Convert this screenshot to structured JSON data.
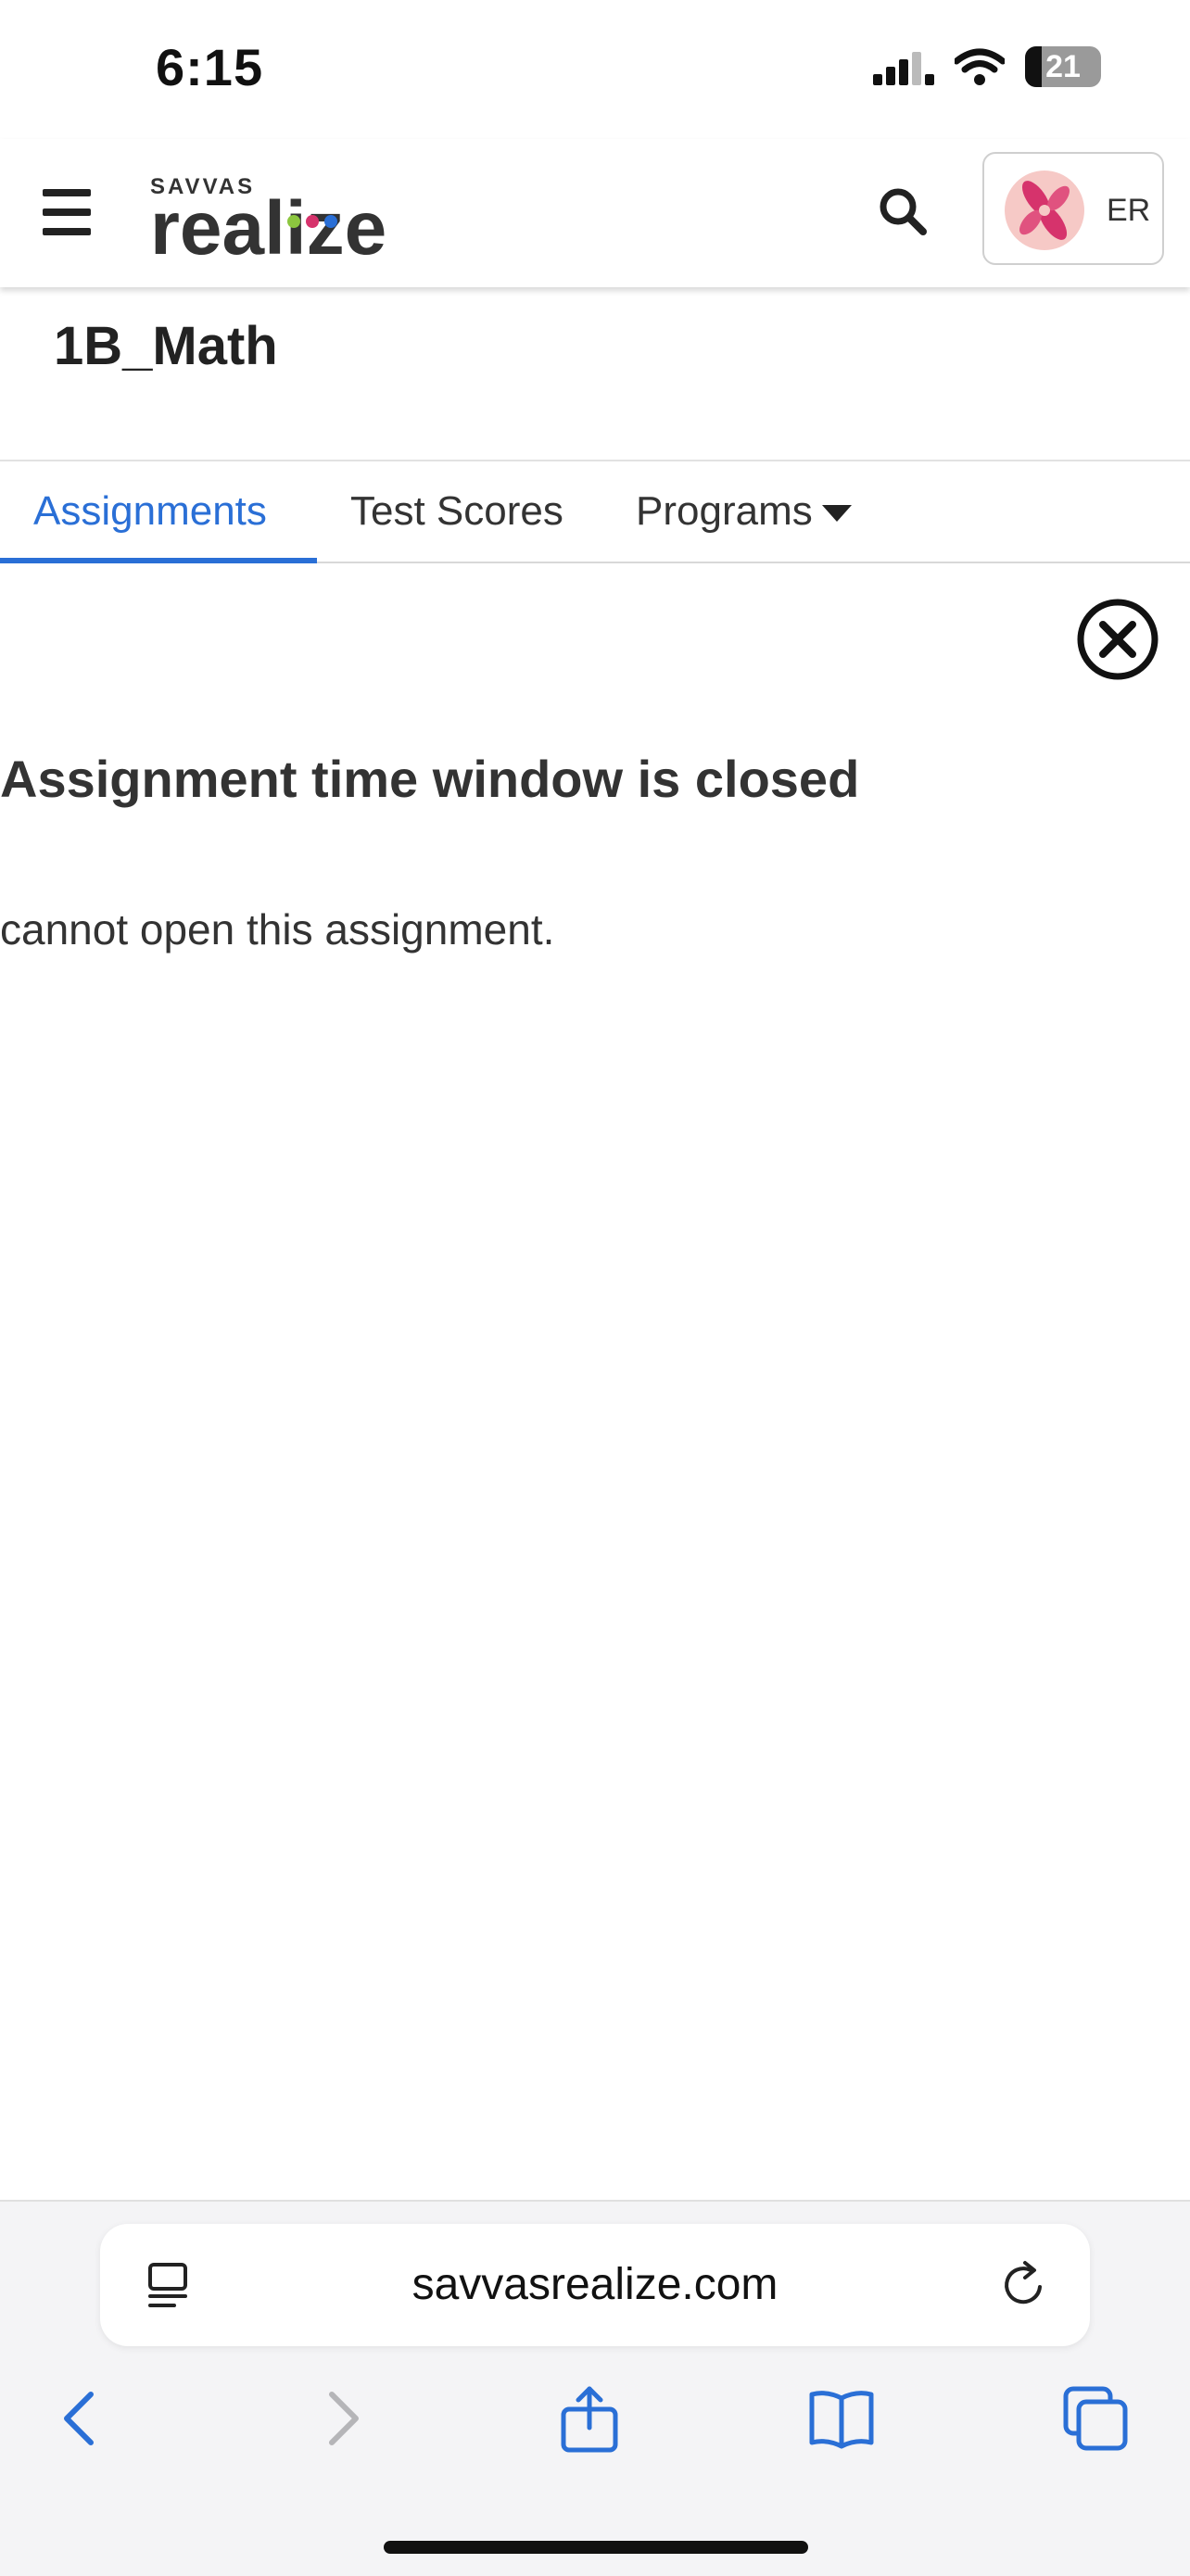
{
  "status_bar": {
    "time": "6:15",
    "battery": "21"
  },
  "header": {
    "logo_top": "SAVVAS",
    "logo_main": "realize",
    "profile_initials": "ER"
  },
  "class_title": "1B_Math",
  "tabs": [
    {
      "label": "Assignments",
      "active": true
    },
    {
      "label": "Test Scores",
      "active": false
    },
    {
      "label": "Programs",
      "active": false
    }
  ],
  "message": {
    "title": "Assignment time window is closed",
    "body": "cannot open this assignment."
  },
  "browser": {
    "url": "savvasrealize.com"
  },
  "colors": {
    "accent": "#2a6fd6",
    "logo_dot_1": "#8cc63f",
    "logo_dot_2": "#d6336c",
    "logo_dot_3": "#2a6fd6"
  },
  "icons": [
    "menu-icon",
    "search-icon",
    "avatar-icon",
    "close-icon",
    "reader-icon",
    "reload-icon",
    "back-icon",
    "forward-icon",
    "share-icon",
    "bookmarks-icon",
    "tabs-icon"
  ]
}
